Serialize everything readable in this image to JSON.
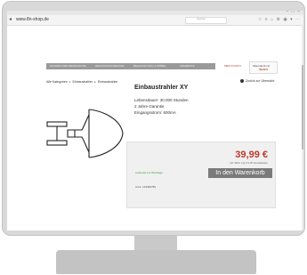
{
  "browser": {
    "window_controls": "– □ ×",
    "back_icon": "◂",
    "url": "www.8n-shop.de",
    "search_placeholder": "Suchen",
    "toolbar_icons": "☆ ≡ ⌂ ⚙ ◉ ▾ ⋯"
  },
  "nav": {
    "items": [
      "SICHERN DER BEWAHRUNG",
      "DEKORATION BEDARF",
      "BELEUCHTUNG & MÖBEL",
      "ANGEBOTE"
    ],
    "account": "MEIN KONTO",
    "cart_label": "Warenkorb (1)",
    "cart_total": "39,99 €"
  },
  "breadcrumb": [
    "Alle Kategorien",
    "Einbaustrahler",
    "Einbaustrahler"
  ],
  "back_overview": "Zurück zur Übersicht",
  "product": {
    "title": "Einbaustrahler XY",
    "features": [
      "Lebensdauer: 30.000 Stunden",
      "2 Jahre Garantie",
      "Eingangsstrom: 600mA"
    ]
  },
  "buy_box": {
    "price": "39,99 €",
    "price_note": "inkl. MwSt. zzgl. € 4,90 Versandkosten",
    "delivery": "Lieferzeit 2-3 Werktage",
    "cart_button": "In den Warenkorb",
    "article_number": "Artnr. 123456789"
  }
}
